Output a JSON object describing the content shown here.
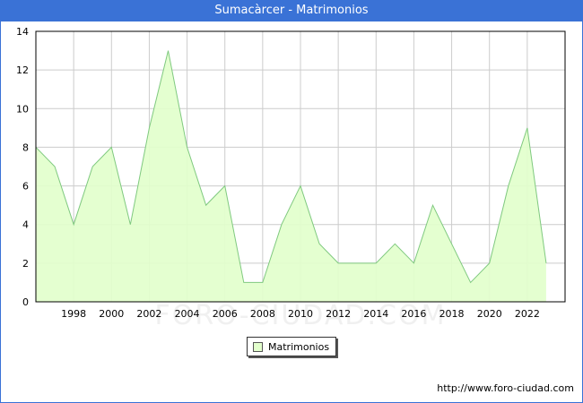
{
  "window": {
    "title": "Sumacàrcer - Matrimonios"
  },
  "legend": {
    "label": "Matrimonios"
  },
  "source_text": "http://www.foro-ciudad.com",
  "watermark": "FORO-CIUDAD.COM",
  "colors": {
    "title_bar": "#3a72d6",
    "area_fill": "#e2ffcc",
    "line": "#7fc97f",
    "grid": "#cccccc"
  },
  "chart_data": {
    "type": "area",
    "title": "Sumacàrcer - Matrimonios",
    "x_tick_labels": [
      "1998",
      "2000",
      "2002",
      "2004",
      "2006",
      "2008",
      "2010",
      "2012",
      "2014",
      "2016",
      "2018",
      "2020",
      "2022"
    ],
    "y_tick_labels": [
      "0",
      "2",
      "4",
      "6",
      "8",
      "10",
      "12",
      "14"
    ],
    "ylim": [
      0,
      14
    ],
    "xlim": [
      1996,
      2024
    ],
    "grid": true,
    "legend_position": "bottom-center",
    "series": [
      {
        "name": "Matrimonios",
        "x": [
          1996,
          1997,
          1998,
          1999,
          2000,
          2001,
          2002,
          2003,
          2004,
          2005,
          2006,
          2007,
          2008,
          2009,
          2010,
          2011,
          2012,
          2013,
          2014,
          2015,
          2016,
          2017,
          2018,
          2019,
          2020,
          2021,
          2022,
          2023
        ],
        "values": [
          8,
          7,
          4,
          7,
          8,
          4,
          9,
          13,
          8,
          5,
          6,
          1,
          1,
          4,
          6,
          3,
          2,
          2,
          2,
          3,
          2,
          5,
          3,
          1,
          2,
          6,
          9,
          2
        ]
      }
    ]
  }
}
